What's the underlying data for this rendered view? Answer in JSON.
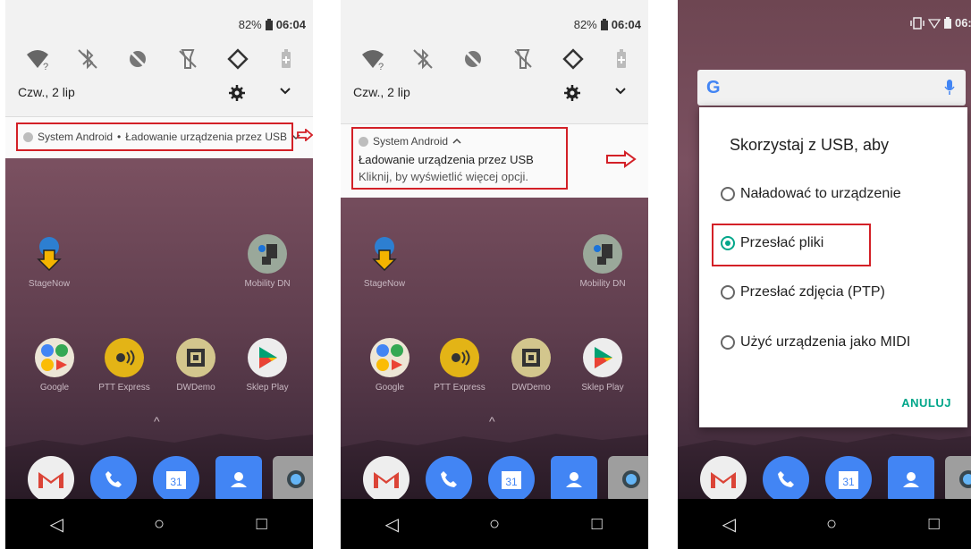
{
  "screen1": {
    "battery": "82%",
    "time": "06:04",
    "date": "Czw., 2 lip",
    "notif_app": "System Android",
    "notif_sep": "•",
    "notif_text": "Ładowanie urządzenia przez USB"
  },
  "screen2": {
    "battery": "82%",
    "time": "06:04",
    "date": "Czw., 2 lip",
    "notif_app": "System Android",
    "notif_title": "Ładowanie urządzenia przez USB",
    "notif_body": "Kliknij, by wyświetlić więcej opcji."
  },
  "screen3": {
    "time": "06:0",
    "dialog_title": "Skorzystaj z USB, aby",
    "options": [
      "Naładować to urządzenie",
      "Przesłać pliki",
      "Przesłać zdjęcia (PTP)",
      "Użyć urządzenia jako MIDI"
    ],
    "selected_index": 1,
    "cancel": "ANULUJ"
  },
  "home": {
    "row1": [
      "StageNow",
      "Mobility DN"
    ],
    "row2": [
      "Google",
      "PTT Express",
      "DWDemo",
      "Sklep Play"
    ]
  },
  "colors": {
    "accent": "#00a68a",
    "highlight": "#d32027"
  },
  "icons": [
    "wifi-icon",
    "bluetooth-off-icon",
    "dnd-icon",
    "flashlight-off-icon",
    "rotate-icon",
    "battery-icon",
    "gear-icon",
    "chevron-down-icon",
    "back-icon",
    "home-icon",
    "recents-icon",
    "google-mic-icon",
    "vibrate-icon"
  ]
}
